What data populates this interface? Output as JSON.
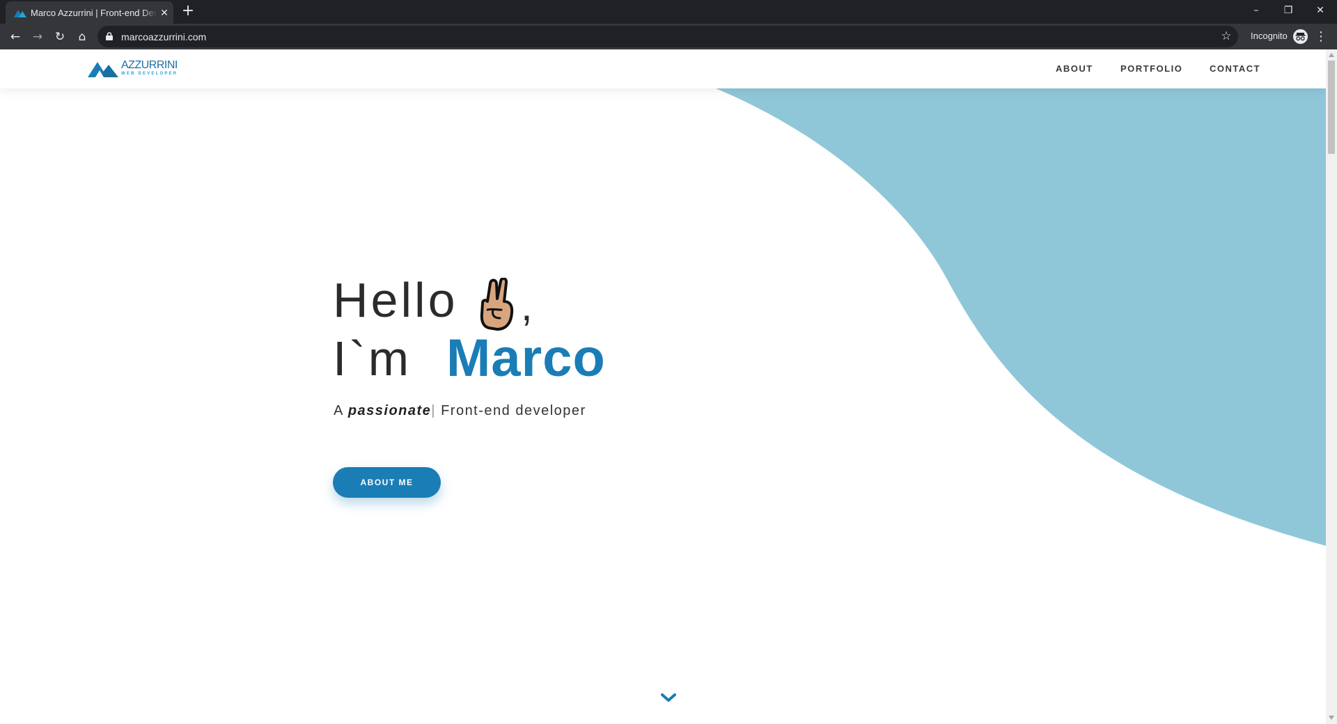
{
  "browser": {
    "tab_title": "Marco Azzurrini | Front-end Developer",
    "url": "marcoazzurrini.com",
    "incognito_label": "Incognito"
  },
  "site": {
    "logo": {
      "word": "AZZURRINI",
      "sub": "WEB DEVELOPER"
    },
    "nav": [
      {
        "label": "ABOUT"
      },
      {
        "label": "PORTFOLIO"
      },
      {
        "label": "CONTACT"
      }
    ],
    "hero": {
      "hello": "Hello",
      "comma": ",",
      "im": "I`m",
      "name": "Marco",
      "subtitle_prefix": "A",
      "subtitle_em": "passionate",
      "subtitle_cursor": "|",
      "subtitle_suffix": "Front-end developer",
      "cta": "ABOUT ME"
    }
  },
  "colors": {
    "brand": "#1a7db6",
    "wave": "#8fc7d9",
    "text": "#2b2b2b"
  },
  "icons": {
    "hello_emoji": "victory-hand-icon",
    "scroll": "chevron-down-icon"
  }
}
